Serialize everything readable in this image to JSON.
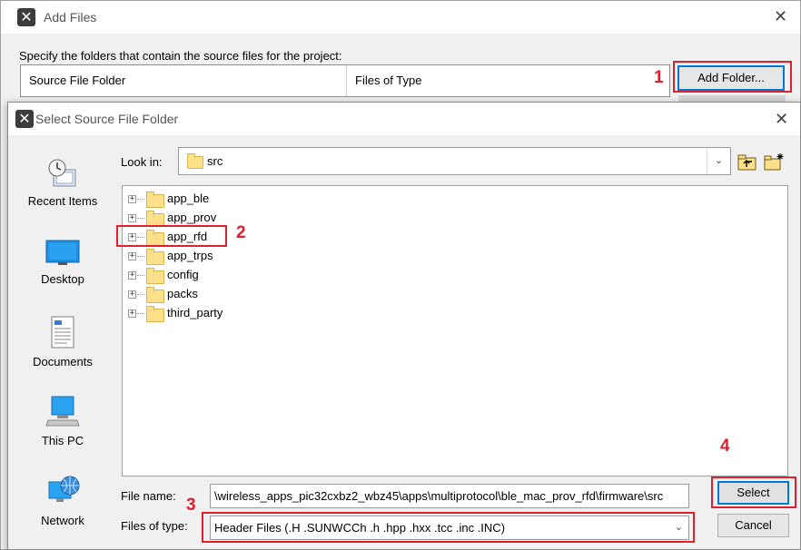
{
  "outer_window": {
    "title": "Add Files",
    "instruction": "Specify the folders that contain the source files for the project:",
    "table_headers": [
      "Source File Folder",
      "Files of Type"
    ],
    "add_folder_label": "Add Folder..."
  },
  "inner_dialog": {
    "title": "Select Source File Folder",
    "places": [
      {
        "label": "Recent Items",
        "icon": "recent-items-icon"
      },
      {
        "label": "Desktop",
        "icon": "desktop-icon"
      },
      {
        "label": "Documents",
        "icon": "documents-icon"
      },
      {
        "label": "This PC",
        "icon": "this-pc-icon"
      },
      {
        "label": "Network",
        "icon": "network-icon"
      }
    ],
    "look_in_label": "Look in:",
    "look_in_value": "src",
    "folders": [
      "app_ble",
      "app_prov",
      "app_rfd",
      "app_trps",
      "config",
      "packs",
      "third_party"
    ],
    "file_name_label": "File name:",
    "file_name_value": "\\wireless_apps_pic32cxbz2_wbz45\\apps\\multiprotocol\\ble_mac_prov_rfd\\firmware\\src",
    "files_of_type_label": "Files of type:",
    "files_of_type_value": "Header Files (.H .SUNWCCh .h .hpp .hxx .tcc .inc .INC)",
    "select_label": "Select",
    "cancel_label": "Cancel"
  },
  "annotations": [
    "1",
    "2",
    "3",
    "4"
  ],
  "colors": {
    "annotation_red": "#e0202a",
    "focus_blue": "#0078d7",
    "folder_yellow": "#ffe08a"
  }
}
